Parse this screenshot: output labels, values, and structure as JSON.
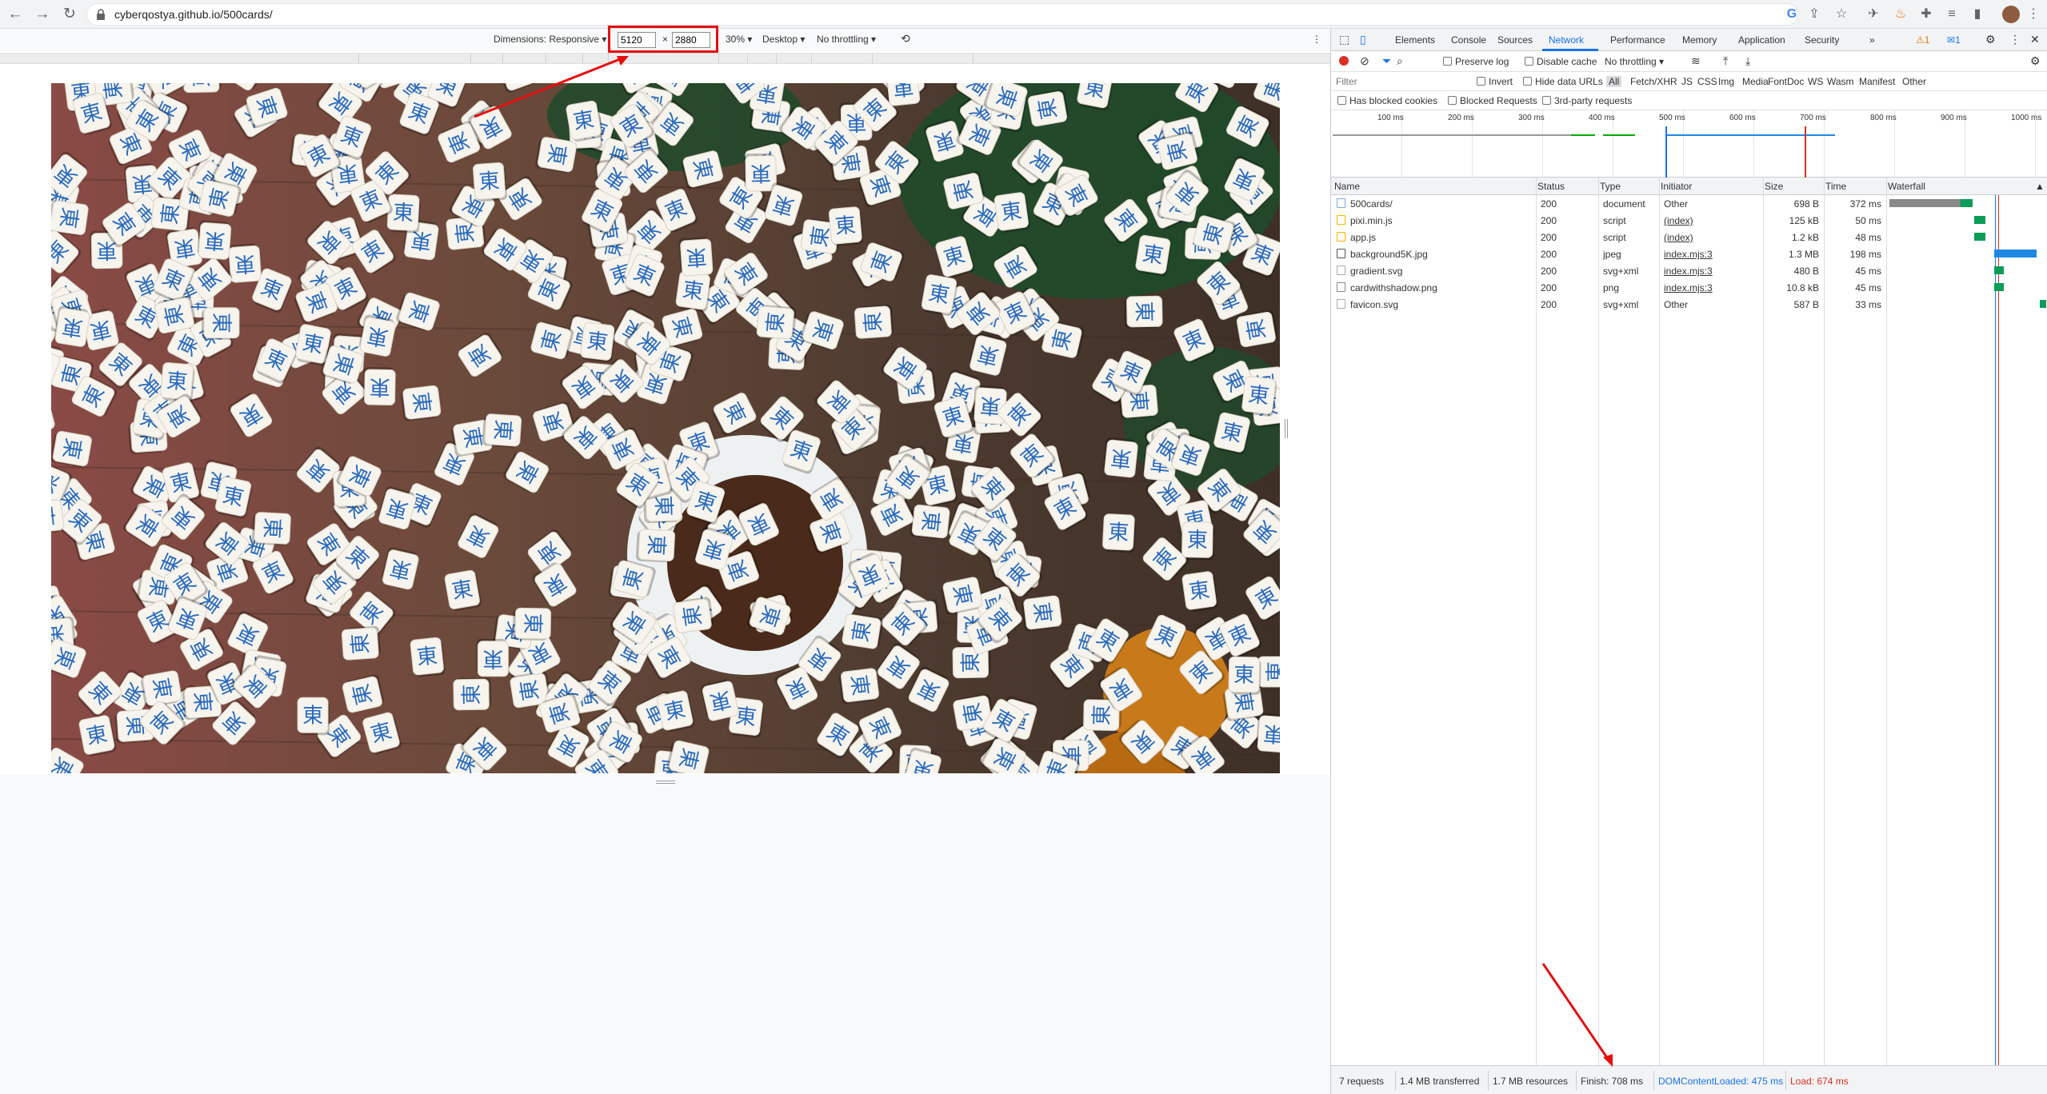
{
  "browser": {
    "url": "cyberqostya.github.io/500cards/",
    "icons": [
      "back-icon",
      "forward-icon",
      "reload-icon",
      "lock-icon",
      "google-icon",
      "share-icon",
      "star-icon",
      "extension-icon",
      "fire-icon",
      "puzzle-icon",
      "menu-icon",
      "sidebar-icon"
    ]
  },
  "device_toolbar": {
    "dimensions_label": "Dimensions: Responsive ▾",
    "width": "5120",
    "times": "×",
    "height": "2880",
    "zoom": "30% ▾",
    "device_type": "Desktop ▾",
    "throttling": "No throttling ▾"
  },
  "game": {
    "tile_glyph": "東",
    "tile_count": 500,
    "colors": {
      "tile": "#f7f4ee",
      "glyph": "#2a6bbd",
      "table": "#6f4c3a"
    }
  },
  "devtools": {
    "tabs": [
      "Elements",
      "Console",
      "Sources",
      "Network",
      "Performance",
      "Memory",
      "Application",
      "Security",
      "»"
    ],
    "active_tab": "Network",
    "warnings": "1",
    "messages": "1",
    "toolbar": {
      "preserve_log": "Preserve log",
      "disable_cache": "Disable cache",
      "throttling": "No throttling"
    },
    "filter": {
      "placeholder": "Filter",
      "invert": "Invert",
      "hide_data_urls": "Hide data URLs",
      "types": [
        "All",
        "Fetch/XHR",
        "JS",
        "CSS",
        "Img",
        "Media",
        "Font",
        "Doc",
        "WS",
        "Wasm",
        "Manifest",
        "Other"
      ]
    },
    "row3": {
      "has_blocked_cookies": "Has blocked cookies",
      "blocked_requests": "Blocked Requests",
      "third_party": "3rd-party requests"
    },
    "overview_ticks": [
      "100 ms",
      "200 ms",
      "300 ms",
      "400 ms",
      "500 ms",
      "600 ms",
      "700 ms",
      "800 ms",
      "900 ms",
      "1000 ms"
    ],
    "columns": [
      "Name",
      "Status",
      "Type",
      "Initiator",
      "Size",
      "Time",
      "Waterfall"
    ],
    "requests": [
      {
        "name": "500cards/",
        "status": "200",
        "type": "document",
        "initiator": "Other",
        "size": "698 B",
        "time": "372 ms",
        "wf_start": 0.0,
        "wf_end": 0.53,
        "link": false
      },
      {
        "name": "pixi.min.js",
        "status": "200",
        "type": "script",
        "initiator": "(index)",
        "size": "125 kB",
        "time": "50 ms",
        "wf_start": 0.54,
        "wf_end": 0.61,
        "link": true
      },
      {
        "name": "app.js",
        "status": "200",
        "type": "script",
        "initiator": "(index)",
        "size": "1.2 kB",
        "time": "48 ms",
        "wf_start": 0.54,
        "wf_end": 0.61,
        "link": true
      },
      {
        "name": "background5K.jpg",
        "status": "200",
        "type": "jpeg",
        "initiator": "index.mjs:3",
        "size": "1.3 MB",
        "time": "198 ms",
        "wf_start": 0.67,
        "wf_end": 0.94,
        "link": true
      },
      {
        "name": "gradient.svg",
        "status": "200",
        "type": "svg+xml",
        "initiator": "index.mjs:3",
        "size": "480 B",
        "time": "45 ms",
        "wf_start": 0.67,
        "wf_end": 0.73,
        "link": true
      },
      {
        "name": "cardwithshadow.png",
        "status": "200",
        "type": "png",
        "initiator": "index.mjs:3",
        "size": "10.8 kB",
        "time": "45 ms",
        "wf_start": 0.67,
        "wf_end": 0.73,
        "link": true
      },
      {
        "name": "favicon.svg",
        "status": "200",
        "type": "svg+xml",
        "initiator": "Other",
        "size": "587 B",
        "time": "33 ms",
        "wf_start": 0.96,
        "wf_end": 1.0,
        "link": false
      }
    ],
    "status_bar": {
      "requests": "7 requests",
      "transferred": "1.4 MB transferred",
      "resources": "1.7 MB resources",
      "finish": "Finish: 708 ms",
      "dom_content_loaded": "DOMContentLoaded: 475 ms",
      "load": "Load: 674 ms"
    }
  }
}
